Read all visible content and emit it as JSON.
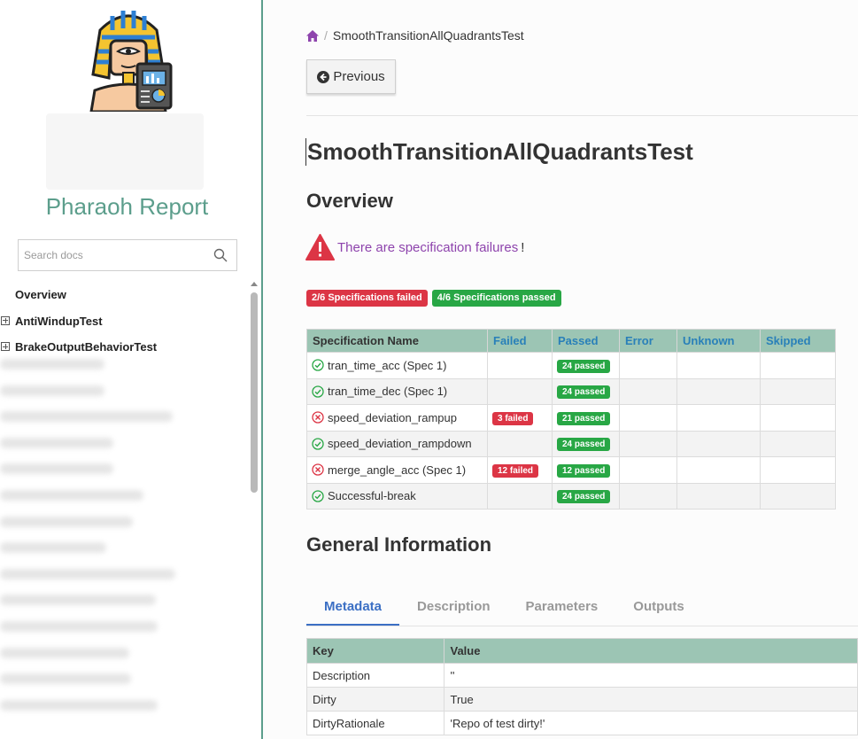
{
  "sidebar": {
    "brand": "Pharaoh Report",
    "search_placeholder": "Search docs",
    "items": [
      {
        "label": "Overview"
      },
      {
        "label": "AntiWindupTest"
      },
      {
        "label": "BrakeOutputBehaviorTest"
      }
    ]
  },
  "breadcrumb": {
    "current": "SmoothTransitionAllQuadrantsTest"
  },
  "prev_button": "Previous",
  "page_title": "SmoothTransitionAllQuadrantsTest",
  "overview": {
    "heading": "Overview",
    "warning_text": "There are specification failures",
    "warning_suffix": "!",
    "failed_badge": "2/6 Specifications failed",
    "passed_badge": "4/6 Specifications passed"
  },
  "spec_table": {
    "headers": [
      "Specification Name",
      "Failed",
      "Passed",
      "Error",
      "Unknown",
      "Skipped"
    ],
    "rows": [
      {
        "name": "tran_time_acc (Spec 1)",
        "status": "pass",
        "failed": "",
        "passed": "24 passed"
      },
      {
        "name": "tran_time_dec (Spec 1)",
        "status": "pass",
        "failed": "",
        "passed": "24 passed"
      },
      {
        "name": "speed_deviation_rampup",
        "status": "fail",
        "failed": "3 failed",
        "passed": "21 passed"
      },
      {
        "name": "speed_deviation_rampdown",
        "status": "pass",
        "failed": "",
        "passed": "24 passed"
      },
      {
        "name": "merge_angle_acc (Spec 1)",
        "status": "fail",
        "failed": "12 failed",
        "passed": "12 passed"
      },
      {
        "name": "Successful-break",
        "status": "pass",
        "failed": "",
        "passed": "24 passed"
      }
    ]
  },
  "general": {
    "heading": "General Information",
    "tabs": [
      "Metadata",
      "Description",
      "Parameters",
      "Outputs"
    ],
    "active_tab": "Metadata"
  },
  "meta_table": {
    "headers": [
      "Key",
      "Value"
    ],
    "rows": [
      {
        "key": "Description",
        "value": "''"
      },
      {
        "key": "Dirty",
        "value": "True"
      },
      {
        "key": "DirtyRationale",
        "value": "'Repo of test dirty!'"
      }
    ]
  },
  "colors": {
    "accent": "#5c9e8c",
    "table_header": "#9cc5b4",
    "danger": "#dc3545",
    "success": "#28a745",
    "warning_text": "#8e44ad",
    "link": "#2980b9"
  },
  "icons": {
    "home": "home-icon",
    "prev": "arrow-circle-left-icon",
    "warn": "warning-triangle-icon",
    "pass": "check-circle-icon",
    "fail": "x-circle-icon",
    "search": "search-icon"
  }
}
